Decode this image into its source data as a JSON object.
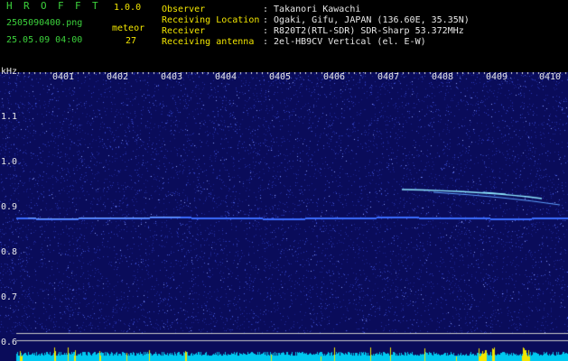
{
  "app": {
    "title_letters": [
      "H",
      "R",
      "O",
      "F",
      "F",
      "T"
    ],
    "version": "1.0.0"
  },
  "file": {
    "name": "2505090400.png",
    "datetime": "25.05.09 04:00"
  },
  "meteor": {
    "label": "meteor",
    "count": "27"
  },
  "info": [
    {
      "label": "Observer",
      "value": ": Takanori Kawachi"
    },
    {
      "label": "Receiving Location",
      "value": ": Ogaki, Gifu, JAPAN (136.60E, 35.35N)"
    },
    {
      "label": "Receiver",
      "value": ": R820T2(RTL-SDR) SDR-Sharp 53.372MHz"
    },
    {
      "label": "Receiving antenna",
      "value": ": 2el-HB9CV Vertical (el. E-W)"
    }
  ],
  "axis": {
    "unit": "kHz",
    "y_ticks": [
      "1.1",
      "1.0",
      "0.9",
      "0.8",
      "0.7",
      "0.6"
    ],
    "x_ticks": [
      "0401",
      "0402",
      "0403",
      "0404",
      "0405",
      "0406",
      "0407",
      "0408",
      "0409",
      "0410"
    ]
  },
  "colors": {
    "background": "#000000",
    "waterfall_bg": "#0a0c5a",
    "carrier": "#3a6cff",
    "meteor": "#8fe8ff",
    "level": "#00c8f0",
    "level_peak": "#f2e600",
    "label_green": "#3cd23c",
    "label_white": "#e8e8e8",
    "label_yellow": "#f2e600"
  }
}
